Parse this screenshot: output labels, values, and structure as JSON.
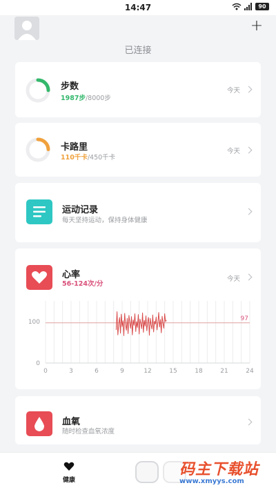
{
  "status_bar": {
    "time": "14:47",
    "battery": "90"
  },
  "header": {
    "connection_status": "已连接",
    "add_label": "+"
  },
  "steps_card": {
    "title": "步数",
    "current": "1987步",
    "goal": "/8000步",
    "period": "今天",
    "progress": 0.248
  },
  "calories_card": {
    "title": "卡路里",
    "current": "110千卡",
    "goal": "/450千卡",
    "period": "今天",
    "progress": 0.244
  },
  "exercise_card": {
    "title": "运动记录",
    "subtitle": "每天坚持运动，保持身体健康"
  },
  "heart_rate_card": {
    "title": "心率",
    "range": "56-124次/分",
    "period": "今天",
    "chart_data": {
      "type": "line",
      "x_ticks": [
        "0",
        "3",
        "6",
        "9",
        "12",
        "15",
        "18",
        "21",
        "24"
      ],
      "y_ticks": [
        "0",
        "100"
      ],
      "xlim": [
        0,
        24
      ],
      "ylim": [
        0,
        150
      ],
      "reference_line": {
        "value": 97,
        "label": "97"
      },
      "series": [
        {
          "x": [
            8.3,
            8.4,
            8.5,
            8.6,
            8.7,
            8.8,
            8.9,
            9.0,
            9.1,
            9.2,
            9.3,
            9.4,
            9.5,
            9.6,
            9.7,
            9.8,
            9.9,
            10.0,
            10.1,
            10.2,
            10.3,
            10.4,
            10.5,
            10.6,
            10.7,
            10.8,
            10.9,
            11.0,
            11.1,
            11.2,
            11.3,
            11.4,
            11.5,
            11.6,
            11.7,
            11.8,
            11.9,
            12.0,
            12.1,
            12.2,
            12.3,
            12.4,
            12.5,
            12.6,
            12.7,
            12.8,
            12.9,
            13.0,
            13.1,
            13.2,
            13.3,
            13.4,
            13.5,
            13.6,
            13.7,
            13.8,
            13.9,
            14.0,
            14.1,
            14.2
          ],
          "y": [
            80,
            124,
            68,
            95,
            110,
            72,
            118,
            88,
            102,
            66,
            120,
            93,
            79,
            108,
            71,
            115,
            97,
            84,
            112,
            68,
            104,
            91,
            119,
            76,
            100,
            86,
            117,
            70,
            106,
            95,
            83,
            121,
            74,
            103,
            89,
            114,
            78,
            99,
            110,
            67,
            108,
            92,
            82,
            116,
            75,
            101,
            94,
            111,
            80,
            98,
            122,
            87,
            105,
            73,
            113,
            96,
            84,
            119,
            100,
            104
          ]
        }
      ]
    }
  },
  "blood_oxygen_card": {
    "title": "血氧",
    "subtitle": "随时检查血氧浓度"
  },
  "tabbar": {
    "health_label": "健康"
  },
  "watermark": {
    "text": "码主下载站",
    "url": "www.xmyys.com"
  },
  "colors": {
    "green": "#34b86c",
    "orange": "#f0a13c",
    "teal": "#2ec7c3",
    "red": "#e84c55",
    "line": "#d94a4a"
  }
}
